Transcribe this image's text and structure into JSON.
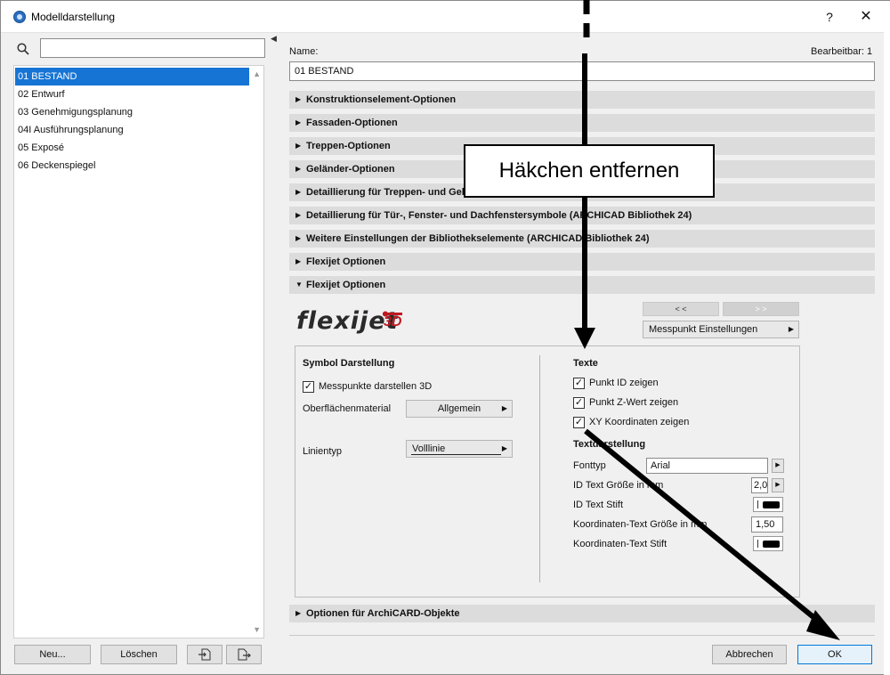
{
  "window": {
    "title": "Modelldarstellung",
    "help": "?",
    "close": "✕"
  },
  "sidebar": {
    "search_placeholder": "",
    "items": [
      {
        "label": "01 BESTAND",
        "selected": true
      },
      {
        "label": "02 Entwurf"
      },
      {
        "label": "03 Genehmigungsplanung"
      },
      {
        "label": "04I Ausführungsplanung"
      },
      {
        "label": "05 Exposé"
      },
      {
        "label": "06 Deckenspiegel"
      }
    ],
    "buttons": {
      "new": "Neu...",
      "delete": "Löschen"
    }
  },
  "main": {
    "name_label": "Name:",
    "editable_label": "Bearbeitbar: 1",
    "name_value": "01 BESTAND",
    "sections": [
      {
        "label": "Konstruktionselement-Optionen",
        "expanded": false
      },
      {
        "label": "Fassaden-Optionen",
        "expanded": false
      },
      {
        "label": "Treppen-Optionen",
        "expanded": false
      },
      {
        "label": "Geländer-Optionen",
        "expanded": false
      },
      {
        "label": "Detaillierung für Treppen- und Geländer",
        "expanded": false
      },
      {
        "label": "Detaillierung für Tür-, Fenster- und Dachfenstersymbole (ARCHICAD Bibliothek 24)",
        "expanded": false
      },
      {
        "label": "Weitere Einstellungen der Bibliothekselemente (ARCHICAD Bibliothek 24)",
        "expanded": false
      },
      {
        "label": "Flexijet Optionen",
        "expanded": false
      },
      {
        "label": "Flexijet Optionen",
        "expanded": true
      }
    ],
    "last_section": {
      "label": "Optionen für ArchiCARD-Objekte",
      "expanded": false
    },
    "logo": {
      "text": "flexijet",
      "suffix": "3D"
    },
    "nav": {
      "prev": "< <",
      "next": "> >"
    },
    "measure_settings": "Messpunkt Einstellungen",
    "symbol": {
      "heading": "Symbol Darstellung",
      "show_points_label": "Messpunkte darstellen 3D",
      "show_points_checked": true,
      "surface_label": "Oberflächenmaterial",
      "surface_value": "Allgemein",
      "linetype_label": "Linientyp",
      "linetype_value": "Volllinie"
    },
    "texts": {
      "heading": "Texte",
      "options": [
        {
          "label": "Punkt ID zeigen",
          "checked": true
        },
        {
          "label": "Punkt Z-Wert zeigen",
          "checked": true
        },
        {
          "label": "XY Koordinaten zeigen",
          "checked": true
        }
      ],
      "display_heading": "Textdarstellung",
      "font_label": "Fonttyp",
      "font_value": "Arial",
      "id_size_label": "ID Text Größe in mm",
      "id_size_value": "2,0",
      "id_pen_label": "ID Text Stift",
      "coord_size_label": "Koordinaten-Text Größe in mm",
      "coord_size_value": "1,50",
      "coord_pen_label": "Koordinaten-Text Stift"
    },
    "buttons": {
      "cancel": "Abbrechen",
      "ok": "OK"
    }
  },
  "annotation": {
    "callout_text": "Häkchen entfernen"
  },
  "colors": {
    "selection": "#1674d4",
    "section_bg": "#dcdcdc",
    "logo_accent": "#c01920"
  }
}
